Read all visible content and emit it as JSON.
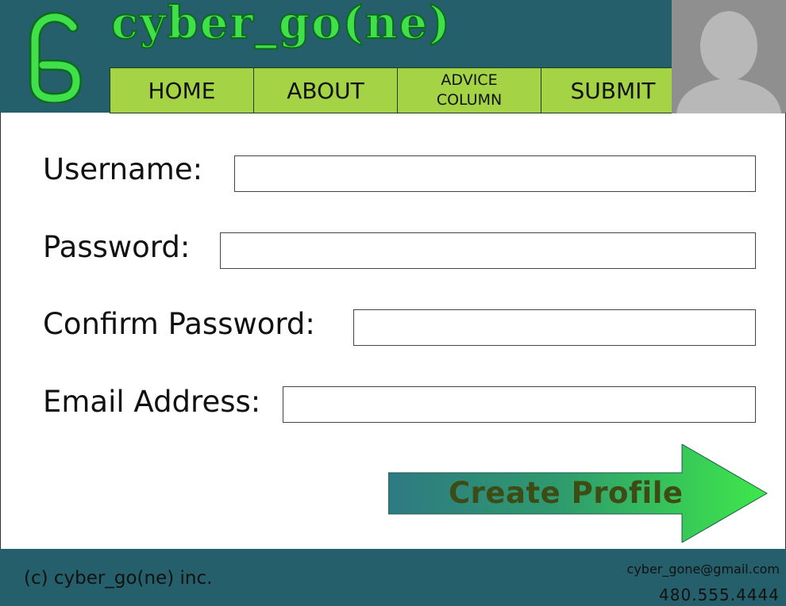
{
  "header": {
    "site_title": "cyber_go(ne)",
    "logo": "cg-monogram-logo",
    "colors": {
      "background": "#245f6b",
      "title": "#3fe04a",
      "nav": "#a4d446"
    }
  },
  "nav": {
    "items": [
      {
        "label": "HOME"
      },
      {
        "label": "ABOUT"
      },
      {
        "label": "ADVICE\nCOLUMN"
      },
      {
        "label": "SUBMIT"
      }
    ]
  },
  "profile": {
    "avatar": "user-silhouette-icon"
  },
  "form": {
    "username_label": "Username:",
    "username_value": "",
    "password_label": "Password:",
    "password_value": "",
    "confirm_password_label": "Confirm Password:",
    "confirm_password_value": "",
    "email_label": "Email Address:",
    "email_value": "",
    "submit_label": "Create Profile"
  },
  "footer": {
    "copyright": "(c) cyber_go(ne) inc.",
    "email": "cyber_gone@gmail.com",
    "phone": "480.555.4444"
  }
}
